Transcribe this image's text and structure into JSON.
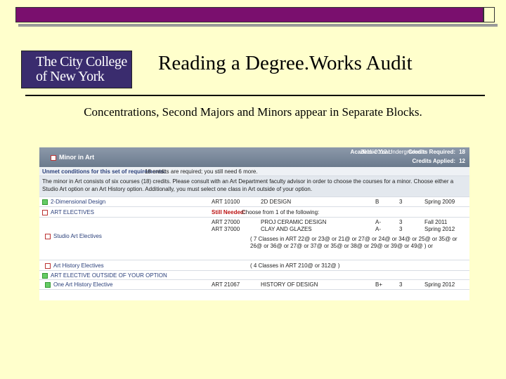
{
  "slide": {
    "logo_line1": "The City College",
    "logo_line2": "of New York",
    "title": "Reading a Degree.Works Audit",
    "subtitle": "Concentrations, Second Majors and Minors appear in Separate Blocks."
  },
  "audit": {
    "block_name": "Minor in Art",
    "academic_year_label": "Academic Year:",
    "academic_year_value": "2011-2012 Undergraduate",
    "credits_required_label": "Credits Required:",
    "credits_required_value": "18",
    "credits_applied_label": "Credits Applied:",
    "credits_applied_value": "12",
    "unmet_label": "Unmet conditions for this set of requirements:",
    "unmet_text": "18 credits are required; you still need 6 more.",
    "description": "The minor in Art consists of six courses (18) credits. Please consult with an Art Department faculty advisor in order to choose the courses for a minor. Choose either a Studio Art option or an Art History option. Additionally, you must select one class in Art outside of your option.",
    "rows": {
      "two_d": {
        "label": "2-Dimensional Design",
        "course": "ART 10100",
        "title": "2D DESIGN",
        "grade": "B",
        "credits": "3",
        "term": "Spring 2009"
      },
      "electives": {
        "label": "ART ELECTIVES",
        "still_needed": "Still Needed:",
        "choose": "Choose from 1 of the following:"
      },
      "studio": {
        "label": "Studio Art Electives",
        "course1": "ART 27000",
        "title1": "PROJ CERAMIC DESIGN",
        "grade1": "A-",
        "credits1": "3",
        "term1": "Fall 2011",
        "course2": "ART 37000",
        "title2": "CLAY AND GLAZES",
        "grade2": "A-",
        "credits2": "3",
        "term2": "Spring 2012",
        "options": "( 7 Classes in ART 22@ or 23@ or 21@ or 27@ or 24@ or 34@ or 25@ or 35@ or 26@ or 36@ or 27@ or 37@ or 35@ or 38@ or 29@ or 39@ or 49@ ) or"
      },
      "history": {
        "label": "Art History Electives",
        "options": "( 4 Classes in ART 210@ or 312@ )"
      },
      "outside": {
        "label": "ART ELECTIVE OUTSIDE OF YOUR OPTION"
      },
      "one_art": {
        "label": "One Art History Elective",
        "course": "ART 21067",
        "title": "HISTORY OF DESIGN",
        "grade": "B+",
        "credits": "3",
        "term": "Spring 2012"
      }
    }
  }
}
